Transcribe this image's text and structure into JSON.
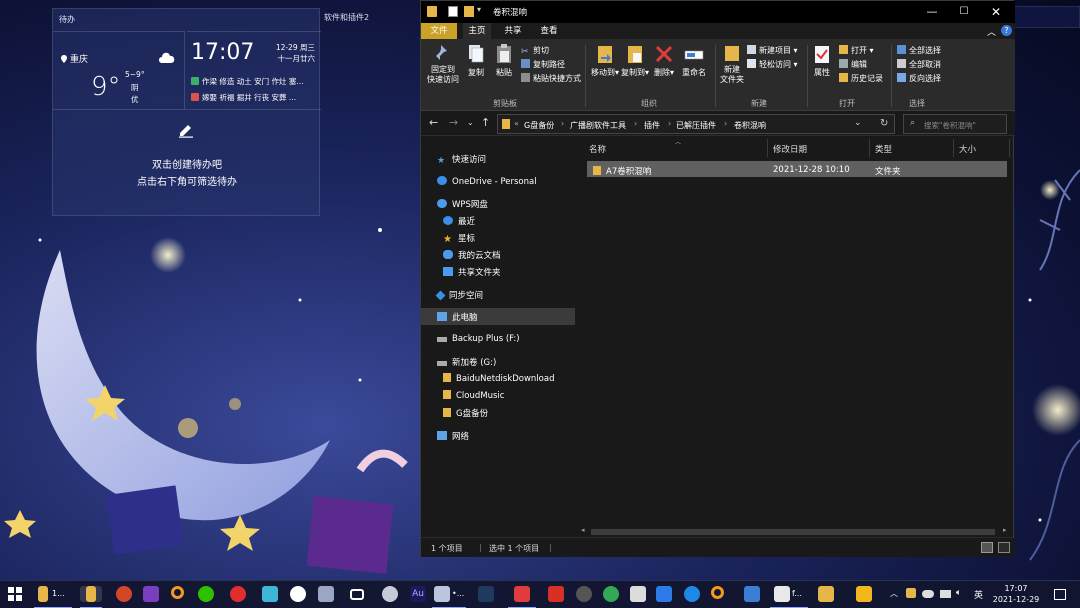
{
  "widget": {
    "title": "待办",
    "weather": {
      "city": "重庆",
      "temp": "9°",
      "range": "5~9°",
      "desc": "阴",
      "aqi": "优"
    },
    "clock": {
      "time": "17:07",
      "date": "12-29 周三",
      "lunar": "十一月廿六",
      "good": "作梁 修造 动土 安门 作灶 塞...",
      "bad": "嫁娶 祈福 掘井 行丧 安葬 ..."
    },
    "todo": {
      "line1": "双击创建待办吧",
      "line2": "点击右下角可筛选待办"
    }
  },
  "desktop_label": "软件和插件2",
  "explorer": {
    "title": "卷积混响",
    "tabs": {
      "file": "文件",
      "home": "主页",
      "share": "共享",
      "view": "查看"
    },
    "ribbon": {
      "pin": "固定到\n快速访问",
      "copy": "复制",
      "paste": "粘贴",
      "cut": "剪切",
      "copy_path": "复制路径",
      "paste_shortcut": "粘贴快捷方式",
      "move_to": "移动到",
      "copy_to": "复制到",
      "delete": "删除",
      "rename": "重命名",
      "new_folder": "新建\n文件夹",
      "new_item": "新建项目",
      "easy_access": "轻松访问",
      "properties": "属性",
      "open": "打开",
      "edit": "编辑",
      "history": "历史记录",
      "select_all": "全部选择",
      "select_none": "全部取消",
      "invert": "反向选择",
      "groups": {
        "clipboard": "剪贴板",
        "organize": "组织",
        "new": "新建",
        "open": "打开",
        "select": "选择"
      }
    },
    "address": {
      "crumbs": [
        "G盘备份",
        "广播剧软件工具",
        "插件",
        "已解压插件",
        "卷积混响"
      ],
      "overflow": "«"
    },
    "search": {
      "placeholder": "搜索\"卷积混响\""
    },
    "nav": {
      "quick_access": "快速访问",
      "onedrive": "OneDrive - Personal",
      "wps": "WPS网盘",
      "recent": "最近",
      "starred": "星标",
      "my_cloud_docs": "我的云文档",
      "shared_folders": "共享文件夹",
      "sync_space": "同步空间",
      "this_pc": "此电脑",
      "backup_plus": "Backup Plus (F:)",
      "new_volume": "新加卷 (G:)",
      "baidu": "BaiduNetdiskDownload",
      "cloudmusic": "CloudMusic",
      "g_backup": "G盘备份",
      "network": "网络"
    },
    "columns": {
      "name": "名称",
      "modified": "修改日期",
      "type": "类型",
      "size": "大小"
    },
    "files": [
      {
        "name": "A7卷积混响",
        "modified": "2021-12-28 10:10",
        "type": "文件夹",
        "size": ""
      }
    ],
    "status": {
      "count": "1 个项目",
      "selected": "选中 1 个项目"
    }
  },
  "taskbar": {
    "explorer_label": "1...",
    "app_label_2": "•...",
    "app_label_3": "f...",
    "ime": "英",
    "time": "17:07",
    "date": "2021-12-29"
  }
}
